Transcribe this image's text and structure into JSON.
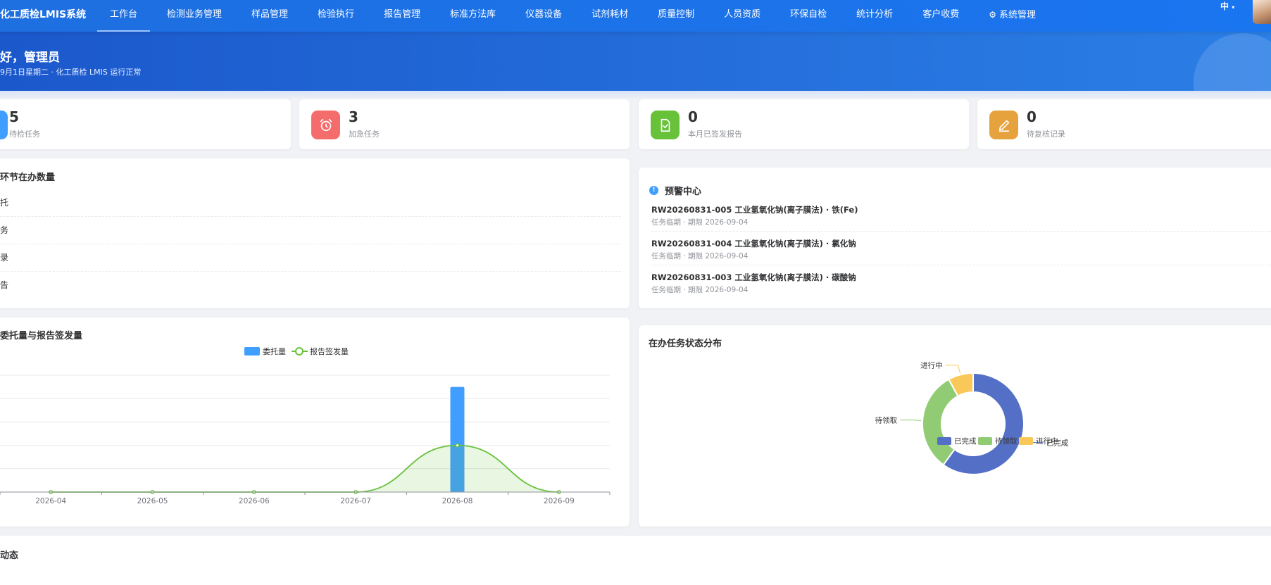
{
  "app": {
    "title": "化工质检LMIS系统",
    "lang": "中"
  },
  "nav": [
    {
      "label": "工作台",
      "active": true
    },
    {
      "label": "检测业务管理"
    },
    {
      "label": "样品管理"
    },
    {
      "label": "检验执行"
    },
    {
      "label": "报告管理"
    },
    {
      "label": "标准方法库"
    },
    {
      "label": "仪器设备"
    },
    {
      "label": "试剂耗材"
    },
    {
      "label": "质量控制"
    },
    {
      "label": "人员资质"
    },
    {
      "label": "环保自检"
    },
    {
      "label": "统计分析"
    },
    {
      "label": "客户收费"
    },
    {
      "label": "系统管理",
      "icon": "gear-icon"
    }
  ],
  "banner": {
    "greeting": "好，管理员",
    "subtitle": "9月1日星期二 · 化工质检 LMIS 运行正常"
  },
  "stats": [
    {
      "value": "5",
      "label": "待检任务",
      "color": "#409eff",
      "icon": "task-icon"
    },
    {
      "value": "3",
      "label": "加急任务",
      "color": "#f56c6c",
      "icon": "alarm-clock-icon"
    },
    {
      "value": "0",
      "label": "本月已签发报告",
      "color": "#67c23a",
      "icon": "signed-report-icon"
    },
    {
      "value": "0",
      "label": "待复核记录",
      "color": "#e6a23c",
      "icon": "edit-pen-icon"
    }
  ],
  "stages": {
    "title": "环节在办数量",
    "items": [
      "托",
      "务",
      "录",
      "告"
    ]
  },
  "alerts": {
    "title": "预警中心",
    "items": [
      {
        "code": "RW20260831-005",
        "title": "工业氢氧化钠(离子膜法) · 铁(Fe)",
        "meta": "任务临期 · 期限 2026-09-04"
      },
      {
        "code": "RW20260831-004",
        "title": "工业氢氧化钠(离子膜法) · 氯化钠",
        "meta": "任务临期 · 期限 2026-09-04"
      },
      {
        "code": "RW20260831-003",
        "title": "工业氢氧化钠(离子膜法) · 碳酸钠",
        "meta": "任务临期 · 期限 2026-09-04"
      }
    ]
  },
  "trend": {
    "title": "委托量与报告签发量"
  },
  "status": {
    "title": "在办任务状态分布"
  },
  "feed": {
    "title": "动态"
  },
  "chart_data": [
    {
      "type": "bar",
      "categories": [
        "2026-04",
        "2026-05",
        "2026-06",
        "2026-07",
        "2026-08",
        "2026-09"
      ],
      "series": [
        {
          "name": "委托量",
          "type": "bar",
          "color": "#409eff",
          "values": [
            0,
            0,
            0,
            0,
            9,
            0
          ]
        },
        {
          "name": "报告签发量",
          "type": "line",
          "smooth": true,
          "area": true,
          "color": "#67c23a",
          "values": [
            0,
            0,
            0,
            0,
            4,
            0
          ]
        }
      ],
      "ylim": [
        0,
        10
      ],
      "grid": true,
      "legend": "top-center"
    },
    {
      "type": "pie",
      "donut": true,
      "slices": [
        {
          "name": "已完成",
          "value": 60,
          "color": "#5470c6"
        },
        {
          "name": "待领取",
          "value": 32,
          "color": "#91cc75"
        },
        {
          "name": "进行中",
          "value": 8,
          "color": "#fac858"
        }
      ],
      "legend": "bottom-center"
    }
  ]
}
